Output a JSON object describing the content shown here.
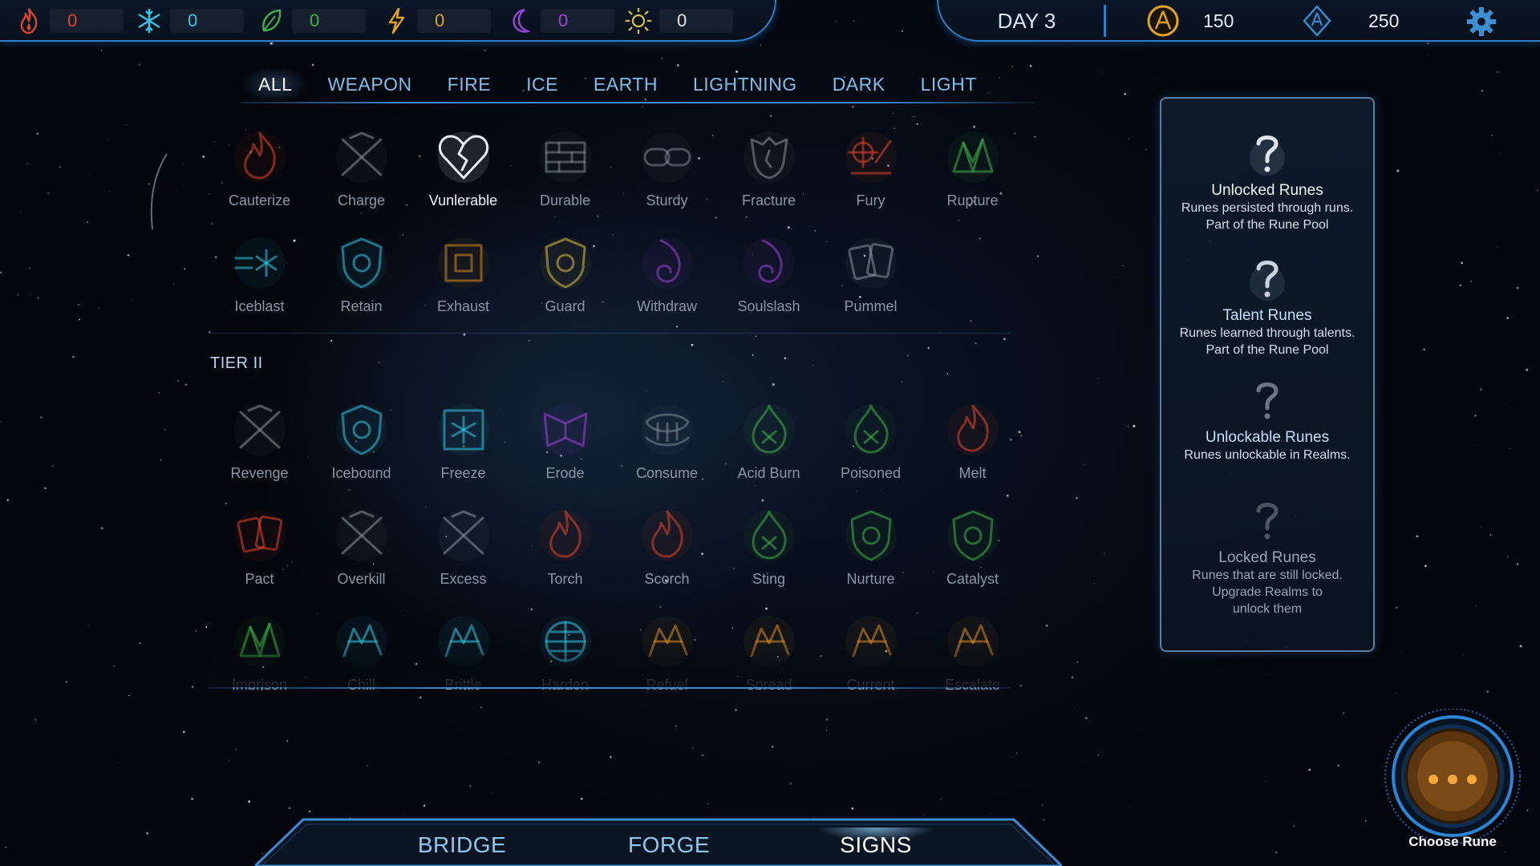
{
  "resources": [
    {
      "name": "fire",
      "icon": "fire-icon",
      "value": "0",
      "color": "#e0452a"
    },
    {
      "name": "ice",
      "icon": "snowflake-icon",
      "value": "0",
      "color": "#31c8e6"
    },
    {
      "name": "earth",
      "icon": "leaf-icon",
      "value": "0",
      "color": "#3fb04a"
    },
    {
      "name": "lightning",
      "icon": "lightning-icon",
      "value": "0",
      "color": "#e3a41f"
    },
    {
      "name": "dark",
      "icon": "moon-icon",
      "value": "0",
      "color": "#9b45d6"
    },
    {
      "name": "light",
      "icon": "sun-icon",
      "value": "0",
      "color": "#d8c04a"
    }
  ],
  "day_label": "DAY 3",
  "currencies": [
    {
      "icon": "gold-rune-coin-icon",
      "value": "150",
      "color": "#e3a41f"
    },
    {
      "icon": "blue-crystal-icon",
      "value": "250",
      "color": "#3c8fd0"
    }
  ],
  "tabs": [
    "ALL",
    "WEAPON",
    "FIRE",
    "ICE",
    "EARTH",
    "LIGHTNING",
    "DARK",
    "LIGHT"
  ],
  "active_tab": "ALL",
  "tier1_runes": [
    {
      "name": "Cauterize",
      "color": "#e0452a",
      "icon": "cauterize-icon",
      "dim": true
    },
    {
      "name": "Charge",
      "color": "#8a93a0",
      "icon": "charge-icon",
      "dim": true
    },
    {
      "name": "Vunlerable",
      "color": "#e8eef6",
      "icon": "broken-heart-icon",
      "dim": false
    },
    {
      "name": "Durable",
      "color": "#7e8794",
      "icon": "brick-wall-icon",
      "dim": true
    },
    {
      "name": "Sturdy",
      "color": "#7e8794",
      "icon": "chain-link-icon",
      "dim": true
    },
    {
      "name": "Fracture",
      "color": "#8a93a0",
      "icon": "cracked-armor-icon",
      "dim": true
    },
    {
      "name": "Fury",
      "color": "#e0452a",
      "icon": "fury-icon",
      "dim": true
    },
    {
      "name": "Rupture",
      "color": "#3fb04a",
      "icon": "rupture-icon",
      "dim": true
    },
    {
      "name": "Iceblast",
      "color": "#31c8e6",
      "icon": "iceblast-icon",
      "dim": true
    },
    {
      "name": "Retain",
      "color": "#31c8e6",
      "icon": "retain-shield-icon",
      "dim": true
    },
    {
      "name": "Exhaust",
      "color": "#d98a24",
      "icon": "exhaust-icon",
      "dim": true
    },
    {
      "name": "Guard",
      "color": "#d8c04a",
      "icon": "guard-shield-icon",
      "dim": true
    },
    {
      "name": "Withdraw",
      "color": "#9b45d6",
      "icon": "withdraw-icon",
      "dim": true
    },
    {
      "name": "Soulslash",
      "color": "#9b45d6",
      "icon": "soulslash-icon",
      "dim": true
    },
    {
      "name": "Pummel",
      "color": "#8a93a0",
      "icon": "pummel-cards-icon",
      "dim": true
    }
  ],
  "tier2_label": "TIER II",
  "tier2_runes": [
    {
      "name": "Revenge",
      "color": "#8a93a0",
      "icon": "revenge-icon",
      "dim": true
    },
    {
      "name": "Icebound",
      "color": "#31c8e6",
      "icon": "icebound-shield-icon",
      "dim": true
    },
    {
      "name": "Freeze",
      "color": "#31c8e6",
      "icon": "freeze-icon",
      "dim": true
    },
    {
      "name": "Erode",
      "color": "#9b45d6",
      "icon": "erode-icon",
      "dim": true
    },
    {
      "name": "Consume",
      "color": "#7e8794",
      "icon": "consume-icon",
      "dim": true
    },
    {
      "name": "Acid Burn",
      "color": "#3fb04a",
      "icon": "acid-burn-icon",
      "dim": true
    },
    {
      "name": "Poisoned",
      "color": "#3fb04a",
      "icon": "poisoned-icon",
      "dim": true
    },
    {
      "name": "Melt",
      "color": "#e0452a",
      "icon": "melt-icon",
      "dim": true
    },
    {
      "name": "Pact",
      "color": "#e0452a",
      "icon": "pact-cards-icon",
      "dim": true
    },
    {
      "name": "Overkill",
      "color": "#8a93a0",
      "icon": "overkill-icon",
      "dim": true
    },
    {
      "name": "Excess",
      "color": "#8a93a0",
      "icon": "excess-icon",
      "dim": true
    },
    {
      "name": "Torch",
      "color": "#e0452a",
      "icon": "torch-icon",
      "dim": true
    },
    {
      "name": "Scorch",
      "color": "#e0452a",
      "icon": "scorch-icon",
      "dim": true
    },
    {
      "name": "Sting",
      "color": "#3fb04a",
      "icon": "sting-icon",
      "dim": true
    },
    {
      "name": "Nurture",
      "color": "#3fb04a",
      "icon": "nurture-shield-icon",
      "dim": true
    },
    {
      "name": "Catalyst",
      "color": "#3fb04a",
      "icon": "catalyst-shield-icon",
      "dim": true
    },
    {
      "name": "Imprison",
      "color": "#3fb04a",
      "icon": "imprison-icon",
      "dim": true
    },
    {
      "name": "Chill",
      "color": "#31c8e6",
      "icon": "chill-icon",
      "dim": true
    },
    {
      "name": "Brittle",
      "color": "#31c8e6",
      "icon": "brittle-icon",
      "dim": true
    },
    {
      "name": "Harden",
      "color": "#31c8e6",
      "icon": "harden-globe-icon",
      "dim": true
    },
    {
      "name": "Refuel",
      "color": "#d98a24",
      "icon": "refuel-icon",
      "dim": true
    },
    {
      "name": "Spread",
      "color": "#d98a24",
      "icon": "spread-icon",
      "dim": true
    },
    {
      "name": "Current",
      "color": "#d98a24",
      "icon": "current-icon",
      "dim": true
    },
    {
      "name": "Escalate",
      "color": "#d98a24",
      "icon": "escalate-icon",
      "dim": true
    }
  ],
  "legend": [
    {
      "title": "Unlocked Runes",
      "desc": [
        "Runes persisted through runs.",
        "Part of the Rune Pool"
      ],
      "title_color": "#f2f5fa",
      "icon": "question-mark-icon"
    },
    {
      "title": "Talent Runes",
      "desc": [
        "Runes learned through talents.",
        "Part of the Rune Pool"
      ],
      "title_color": "#bfe3ff",
      "icon": "question-mark-icon"
    },
    {
      "title": "Unlockable Runes",
      "desc": [
        "Runes unlockable in Realms."
      ],
      "title_color": "#bfe3ff",
      "icon": "question-mark-icon"
    },
    {
      "title": "Locked Runes",
      "desc": [
        "Runes that are still locked.",
        "Upgrade Realms to",
        "unlock them"
      ],
      "title_color": "#9aa4b2",
      "icon": "question-mark-icon"
    }
  ],
  "bottom_nav": [
    "BRIDGE",
    "FORGE",
    "SIGNS"
  ],
  "bottom_nav_active": "SIGNS",
  "choose_rune_label": "Choose Rune"
}
